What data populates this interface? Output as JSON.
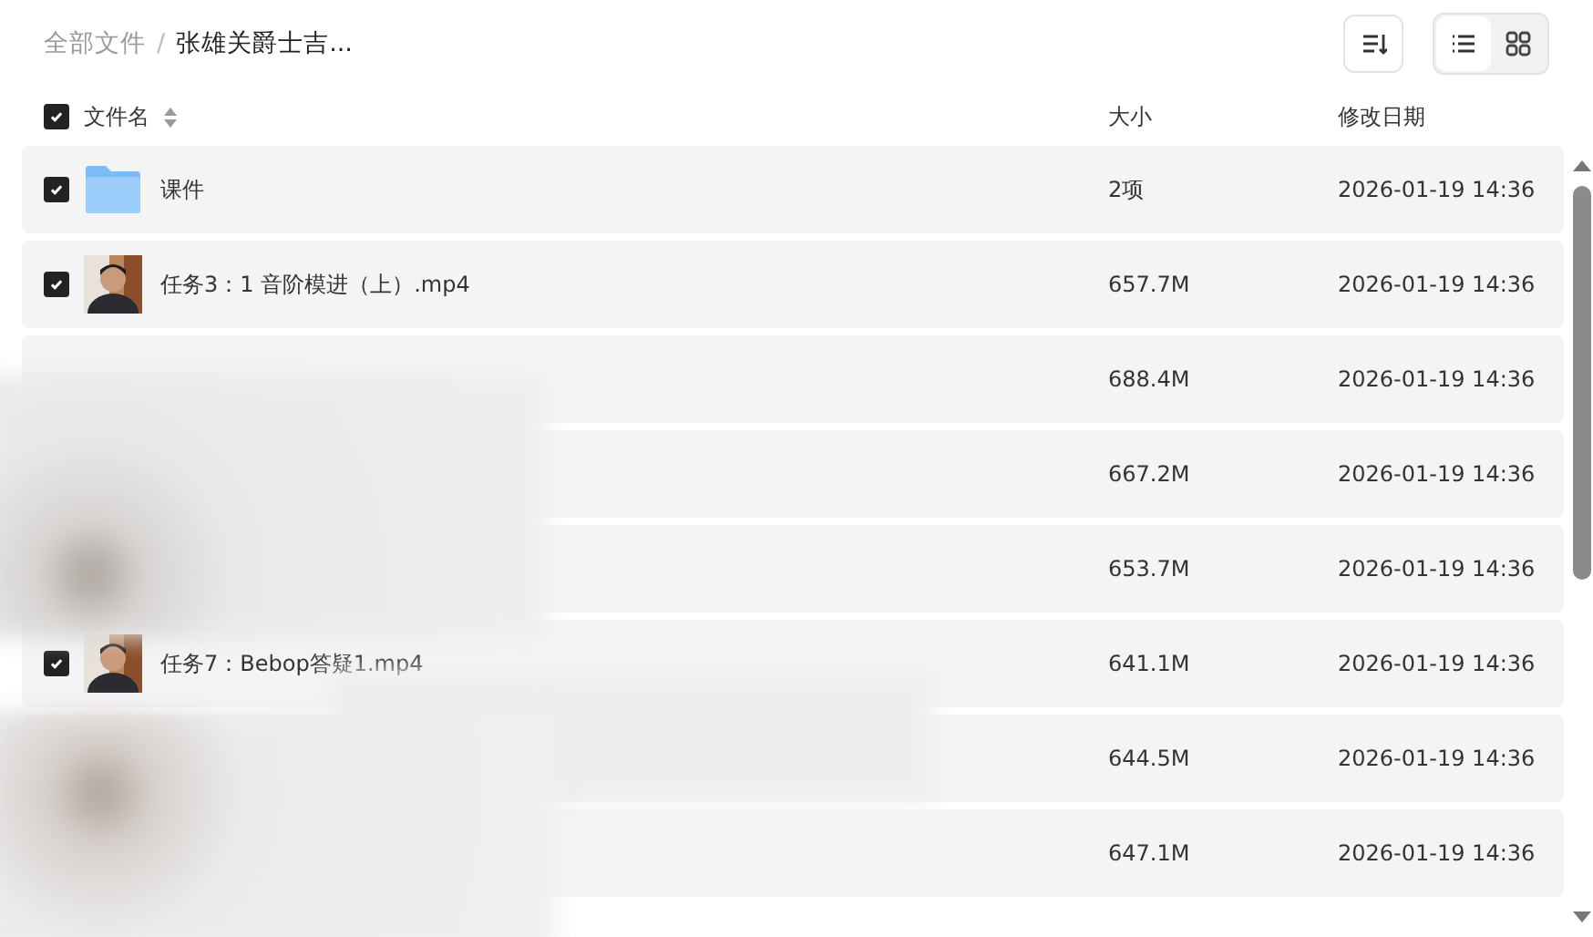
{
  "breadcrumb_separator": "/",
  "breadcrumb": [
    {
      "label": "全部文件",
      "current": false
    },
    {
      "label": "张雄关爵士吉...",
      "current": true
    }
  ],
  "view_toggle": [
    {
      "kind": "list",
      "selected": true
    },
    {
      "kind": "grid",
      "selected": false
    }
  ],
  "header": {
    "checked": true,
    "columns": [
      "文件名",
      "大小",
      "修改日期"
    ]
  },
  "rows": [
    {
      "kind": "folder",
      "checked": true,
      "name": "课件",
      "size": "2项",
      "date": "2026-01-19 14:36"
    },
    {
      "kind": "video",
      "checked": true,
      "name": "任务3：1 音阶模进（上）.mp4",
      "size": "657.7M",
      "date": "2026-01-19 14:36"
    },
    {
      "kind": "hidden",
      "size": "688.4M",
      "date": "2026-01-19 14:36"
    },
    {
      "kind": "hidden",
      "size": "667.2M",
      "date": "2026-01-19 14:36"
    },
    {
      "kind": "hidden",
      "size": "653.7M",
      "date": "2026-01-19 14:36"
    },
    {
      "kind": "video",
      "checked": true,
      "name": "任务7：Bebop答疑1.mp4",
      "size": "641.1M",
      "date": "2026-01-19 14:36"
    },
    {
      "kind": "hidden",
      "size": "644.5M",
      "date": "2026-01-19 14:36"
    },
    {
      "kind": "hidden",
      "size": "647.1M",
      "date": "2026-01-19 14:36"
    }
  ]
}
